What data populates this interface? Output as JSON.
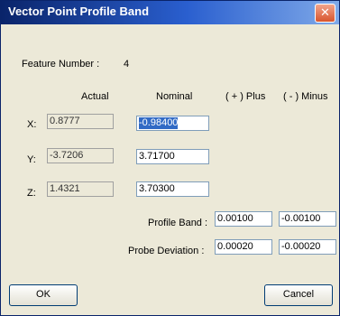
{
  "window": {
    "title": "Vector Point Profile Band",
    "close_glyph": "✕"
  },
  "feature": {
    "label": "Feature Number :",
    "value": "4"
  },
  "columns": {
    "actual": "Actual",
    "nominal": "Nominal",
    "plus": "( + ) Plus",
    "minus": "( - ) Minus"
  },
  "rows": [
    {
      "axis": "X:",
      "actual": "0.8777",
      "nominal": "-0.98400"
    },
    {
      "axis": "Y:",
      "actual": "-3.7206",
      "nominal": "3.71700"
    },
    {
      "axis": "Z:",
      "actual": "1.4321",
      "nominal": "3.70300"
    }
  ],
  "profile_band": {
    "label": "Profile Band :",
    "plus": "0.00100",
    "minus": "-0.00100"
  },
  "probe_deviation": {
    "label": "Probe Deviation :",
    "plus": "0.00020",
    "minus": "-0.00020"
  },
  "buttons": {
    "ok": "OK",
    "cancel": "Cancel"
  }
}
